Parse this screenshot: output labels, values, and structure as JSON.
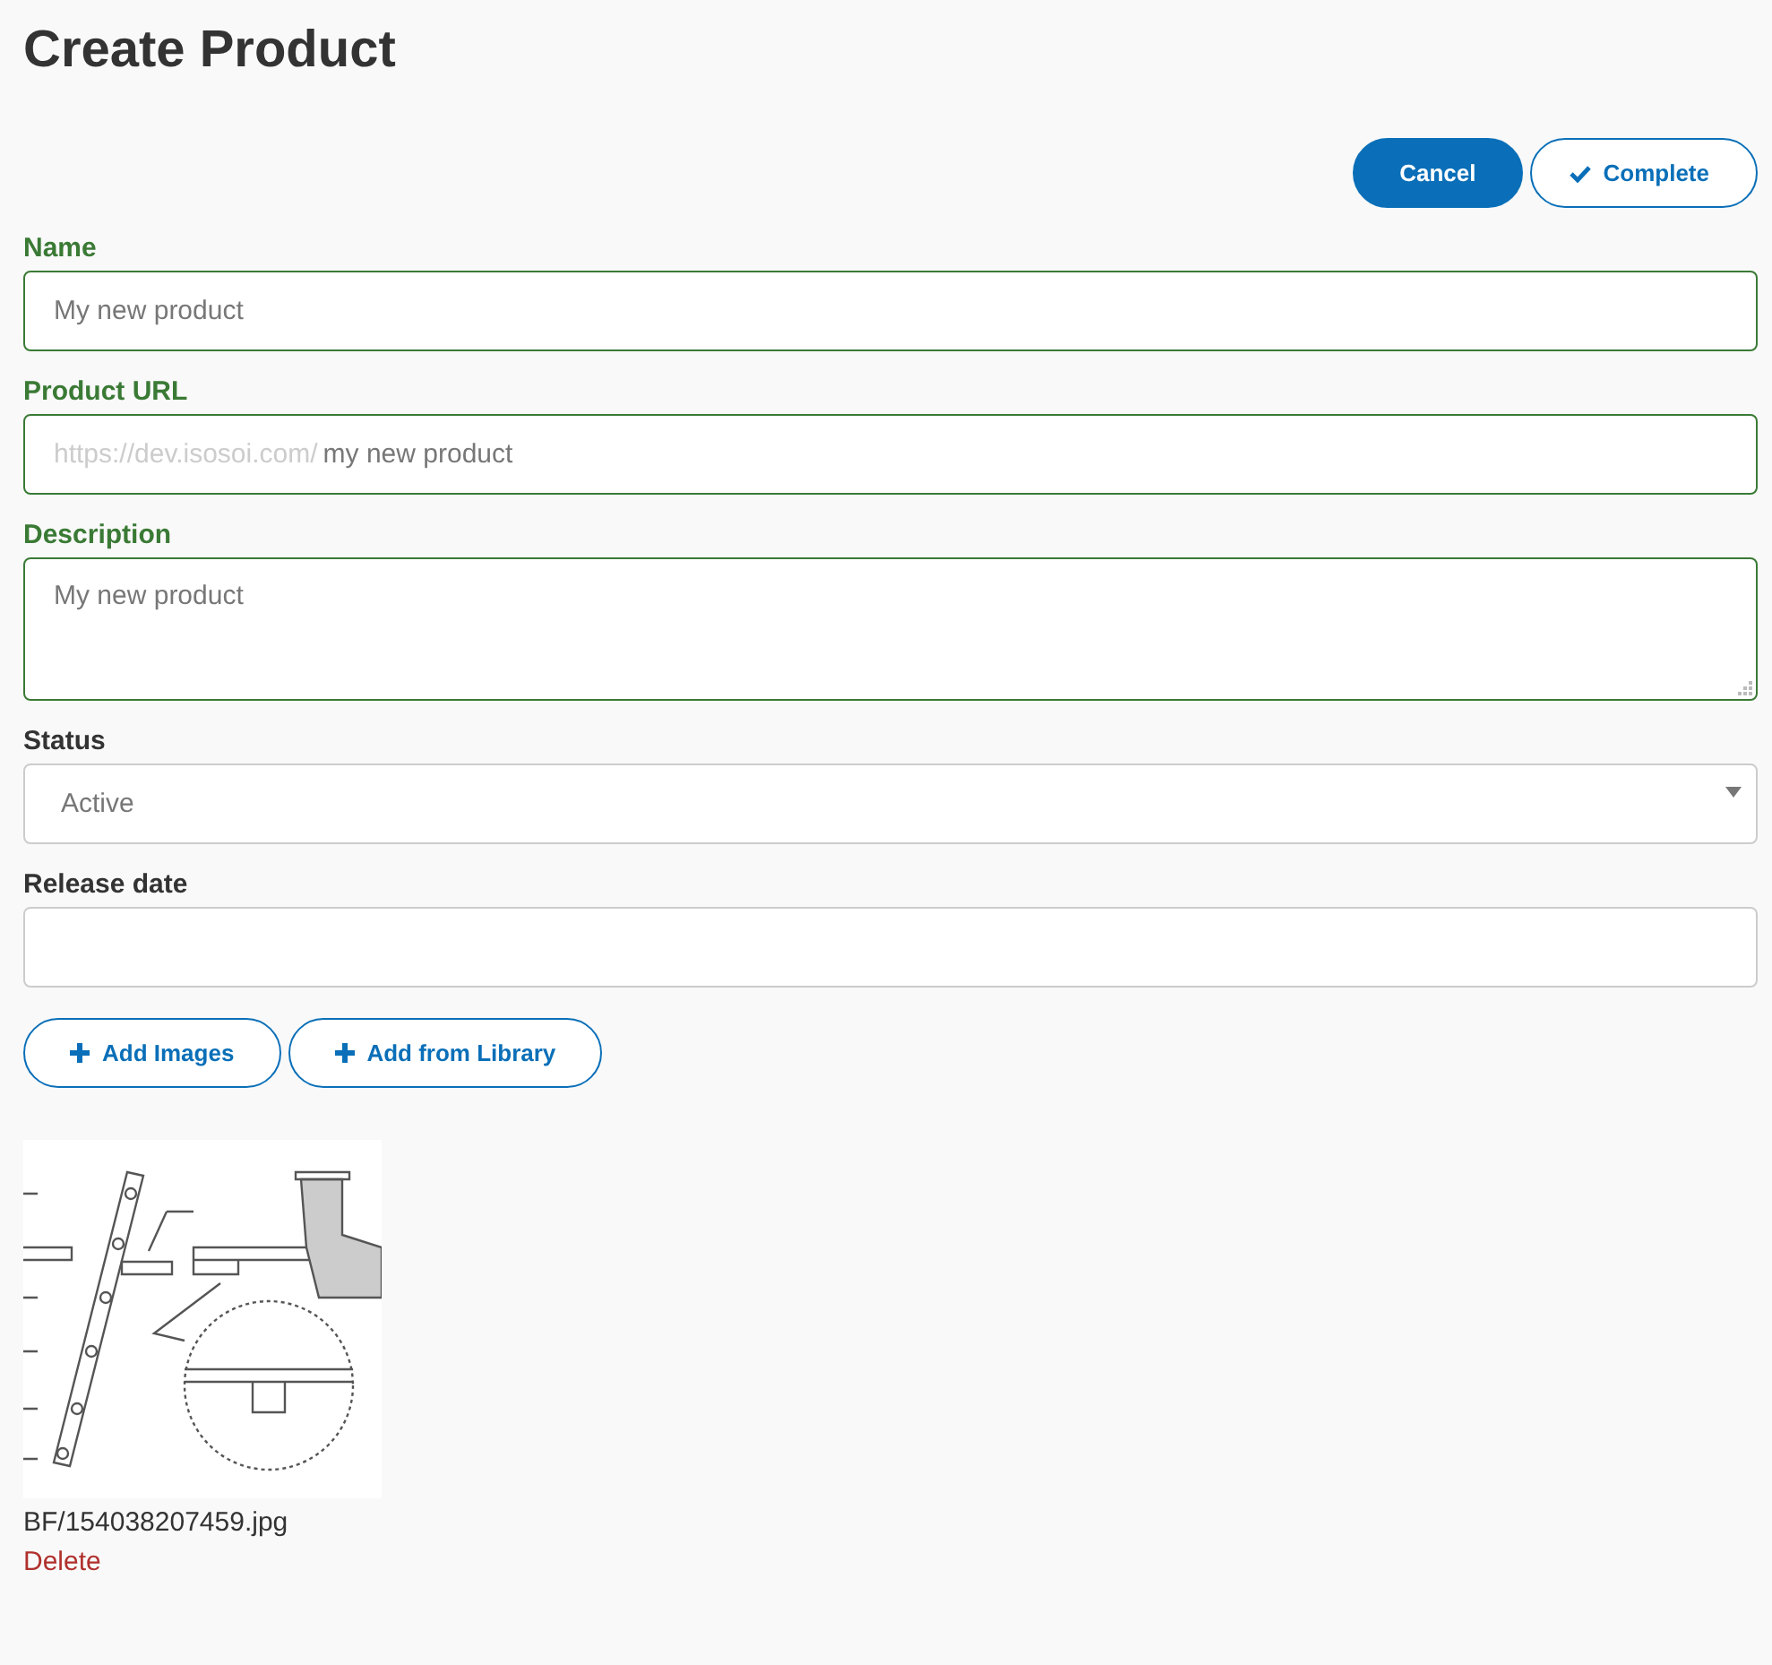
{
  "page_title": "Create Product",
  "header_buttons": [
    {
      "label": "Cancel",
      "kind": "primary"
    },
    {
      "label": "Complete",
      "kind": "check"
    }
  ],
  "fields": [
    {
      "label": "Name",
      "kind": "text",
      "valid": true,
      "value": "My new product"
    },
    {
      "label": "Product URL",
      "kind": "url",
      "valid": true,
      "prefix": "https://dev.isosoi.com/",
      "value": "my new product"
    },
    {
      "label": "Description",
      "kind": "textarea",
      "valid": true,
      "value": "My new product"
    },
    {
      "label": "Status",
      "kind": "select",
      "valid": false,
      "value": "Active"
    },
    {
      "label": "Release date",
      "kind": "date",
      "valid": false
    }
  ],
  "image_buttons": [
    "Add Images",
    "Add from Library"
  ],
  "images": [
    {
      "filename": "BF/154038207459.jpg",
      "delete_label": "Delete"
    }
  ]
}
